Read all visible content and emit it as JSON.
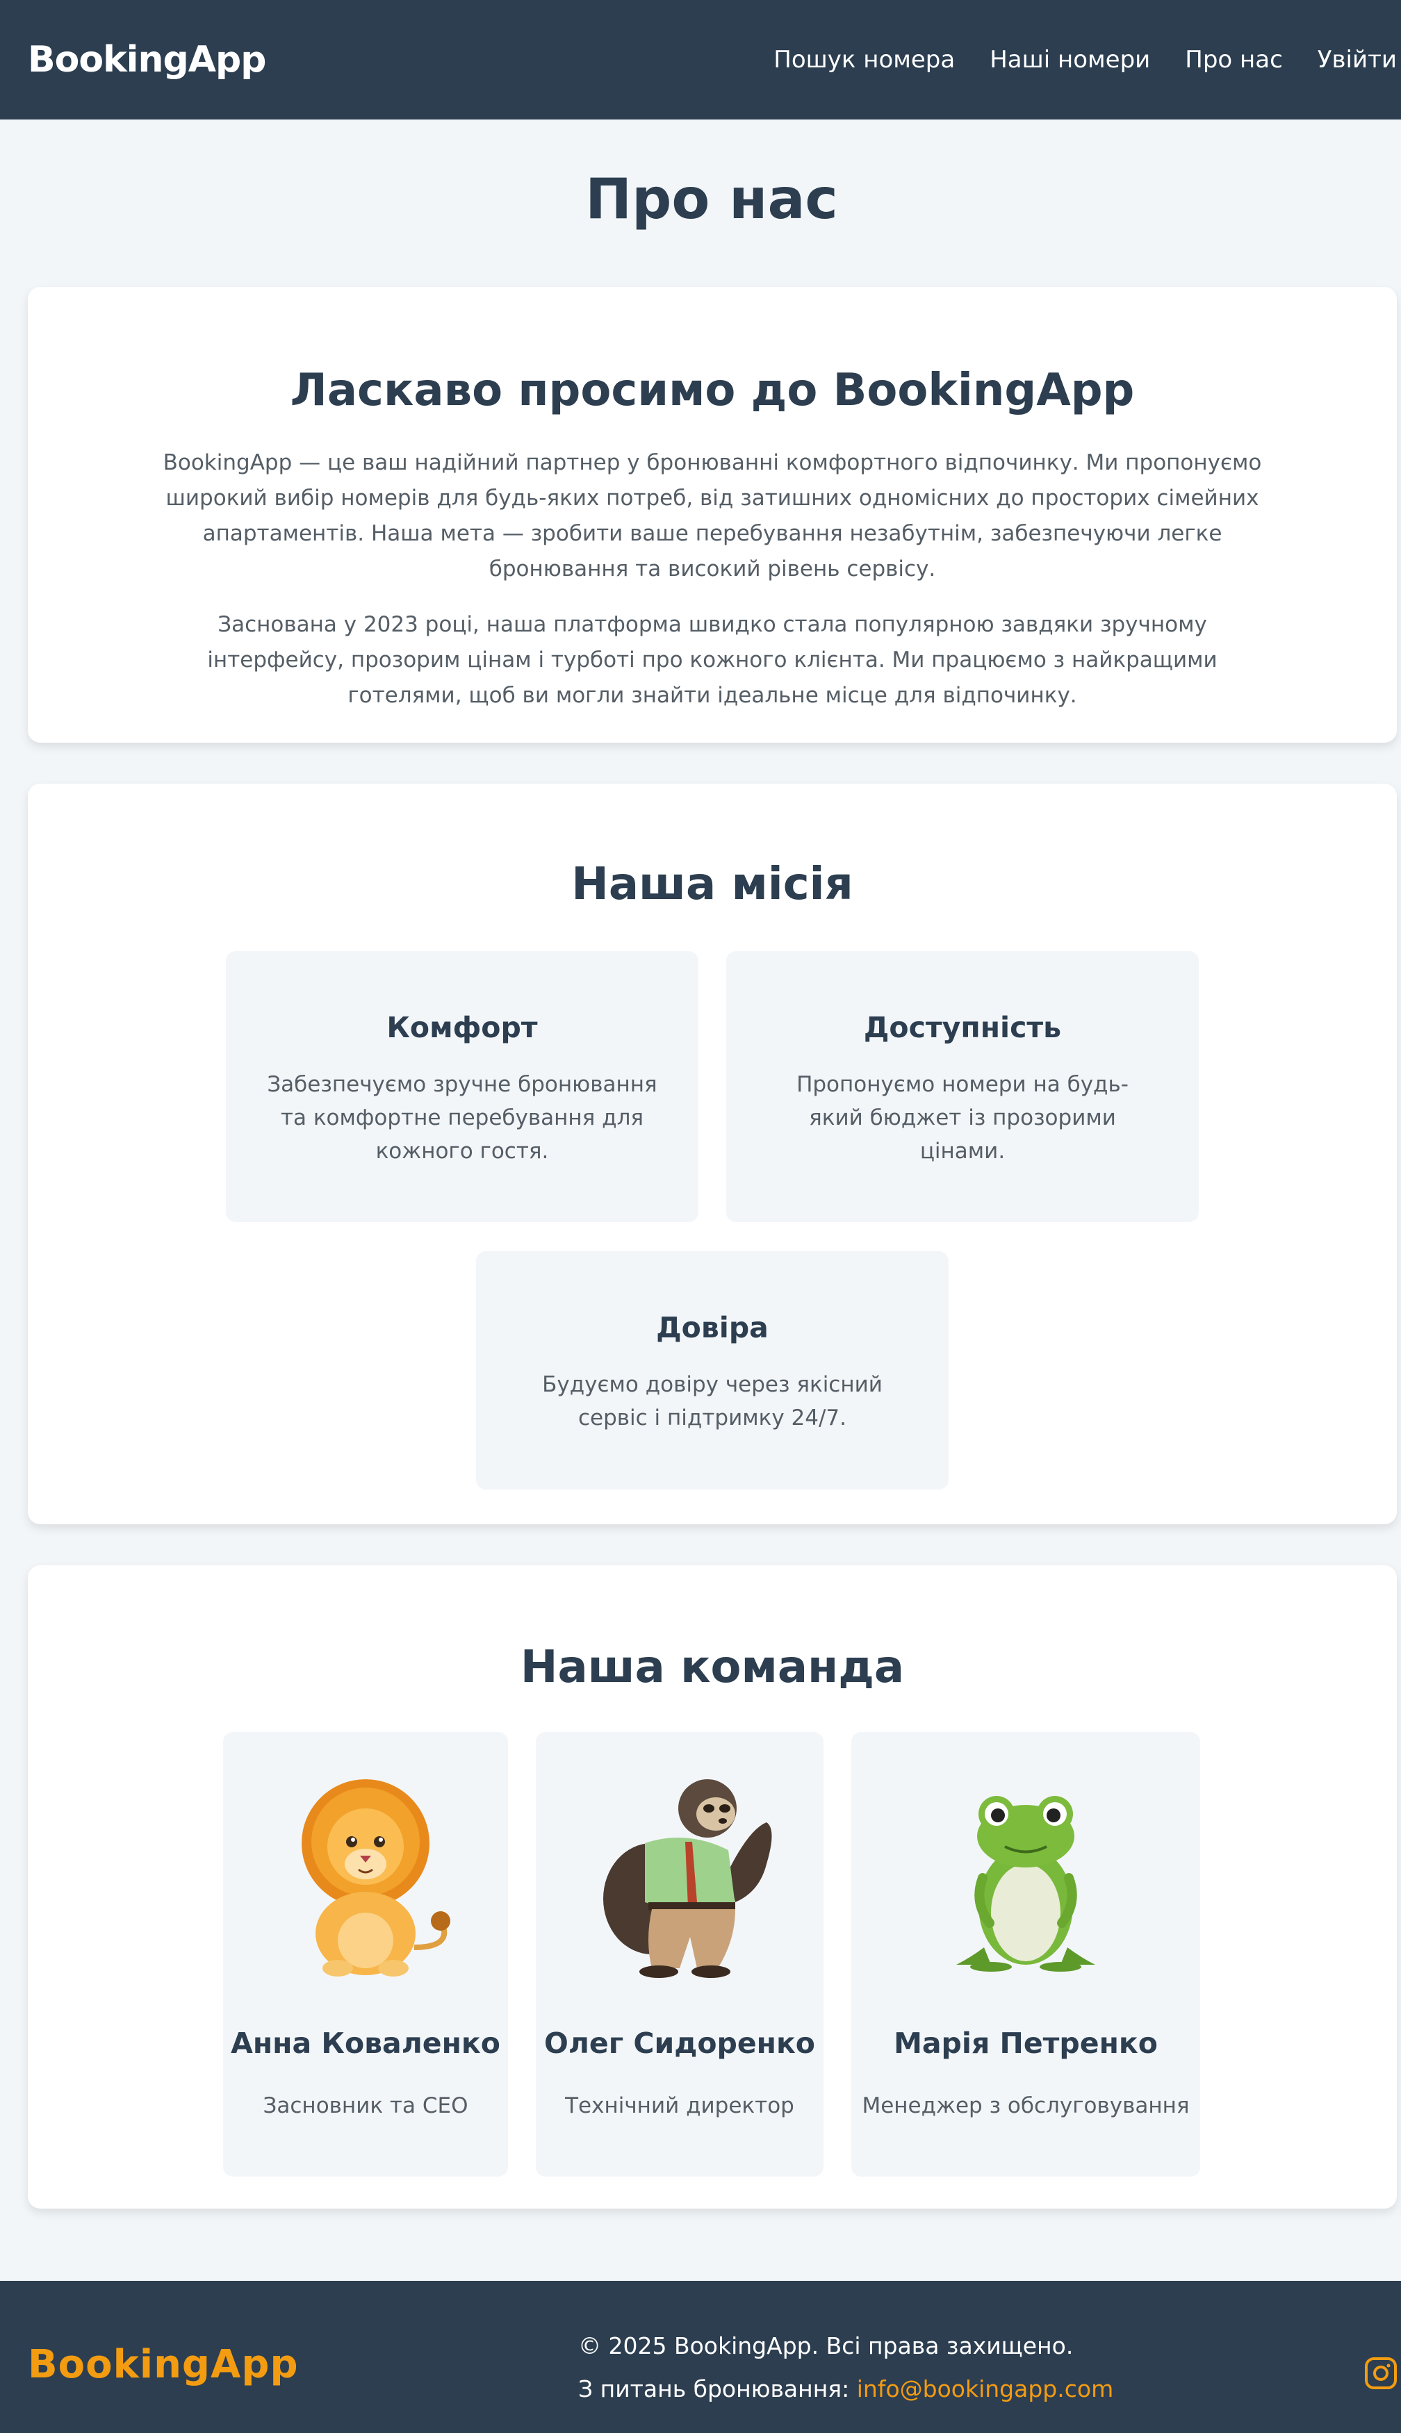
{
  "header": {
    "logo": "BookingApp",
    "nav": [
      "Пошук номера",
      "Наші номери",
      "Про нас",
      "Увійти"
    ]
  },
  "page_title": "Про нас",
  "about": {
    "title_prefix": "Ласкаво просимо до ",
    "title_brand": "BookingApp",
    "p1": "BookingApp — це ваш надійний партнер у бронюванні комфортного відпочинку. Ми пропонуємо широкий вибір номерів для будь-яких потреб, від затишних одномісних до просторих сімейних апартаментів. Наша мета — зробити ваше перебування незабутнім, забезпечуючи легке бронювання та високий рівень сервісу.",
    "p2": "Заснована у 2023 році, наша платформа швидко стала популярною завдяки зручному інтерфейсу, прозорим цінам і турботі про кожного клієнта. Ми працюємо з найкращими готелями, щоб ви могли знайти ідеальне місце для відпочинку."
  },
  "mission": {
    "title": "Наша місія",
    "items": [
      {
        "title": "Комфорт",
        "text": "Забезпечуємо зручне бронювання та комфортне перебування для кожного гостя."
      },
      {
        "title": "Доступність",
        "text": "Пропонуємо номери на будь-який бюджет із прозорими цінами."
      },
      {
        "title": "Довіра",
        "text": "Будуємо довіру через якісний сервіс і підтримку 24/7."
      }
    ]
  },
  "team": {
    "title": "Наша команда",
    "members": [
      {
        "name": "Анна Коваленко",
        "role": "Засновник та CEO",
        "avatar": "lion-icon"
      },
      {
        "name": "Олег Сидоренко",
        "role": "Технічний директор",
        "avatar": "sloth-icon"
      },
      {
        "name": "Марія Петренко",
        "role": "Менеджер з обслуговування",
        "avatar": "frog-icon"
      }
    ]
  },
  "footer": {
    "logo": "BookingApp",
    "copyright": "© 2025 BookingApp. Всі права захищено.",
    "contact_label": "З питань бронювання: ",
    "email": "info@bookingapp.com",
    "social_icon": "instagram-icon"
  },
  "colors": {
    "header_bg": "#2c3e50",
    "accent": "#f39c12",
    "page_bg": "#f3f6f9",
    "card_bg": "#ffffff"
  }
}
